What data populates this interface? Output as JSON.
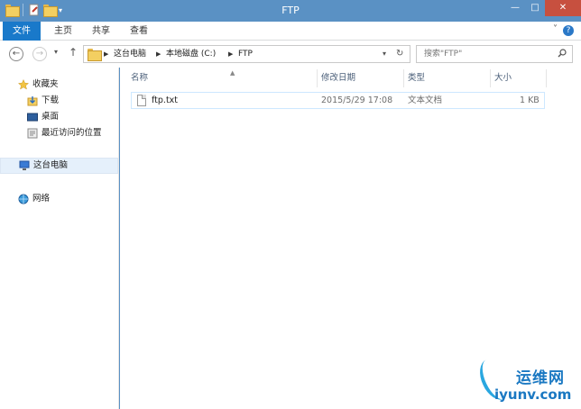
{
  "window": {
    "title": "FTP"
  },
  "titlebar": {
    "minimize": "—",
    "maximize": "□",
    "close": "✕"
  },
  "ribbon": {
    "tabs": [
      {
        "label": "文件"
      },
      {
        "label": "主页"
      },
      {
        "label": "共享"
      },
      {
        "label": "查看"
      }
    ],
    "help": "?",
    "collapse": "˅"
  },
  "address": {
    "crumbs": [
      "这台电脑",
      "本地磁盘 (C:)",
      "FTP"
    ]
  },
  "search": {
    "placeholder": "搜索\"FTP\""
  },
  "nav": {
    "favorites": "收藏夹",
    "downloads": "下载",
    "desktop": "桌面",
    "recent": "最近访问的位置",
    "this_pc": "这台电脑",
    "network": "网络"
  },
  "columns": {
    "name": "名称",
    "modified": "修改日期",
    "type": "类型",
    "size": "大小"
  },
  "files": [
    {
      "name": "ftp.txt",
      "modified": "2015/5/29 17:08",
      "type": "文本文档",
      "size": "1 KB"
    }
  ],
  "watermark": {
    "cn": "运维网",
    "en": "iyunv.com"
  },
  "colors": {
    "titlebar": "#5a91c4",
    "file_tab": "#1979ca",
    "selection": "#e5f0fb"
  }
}
